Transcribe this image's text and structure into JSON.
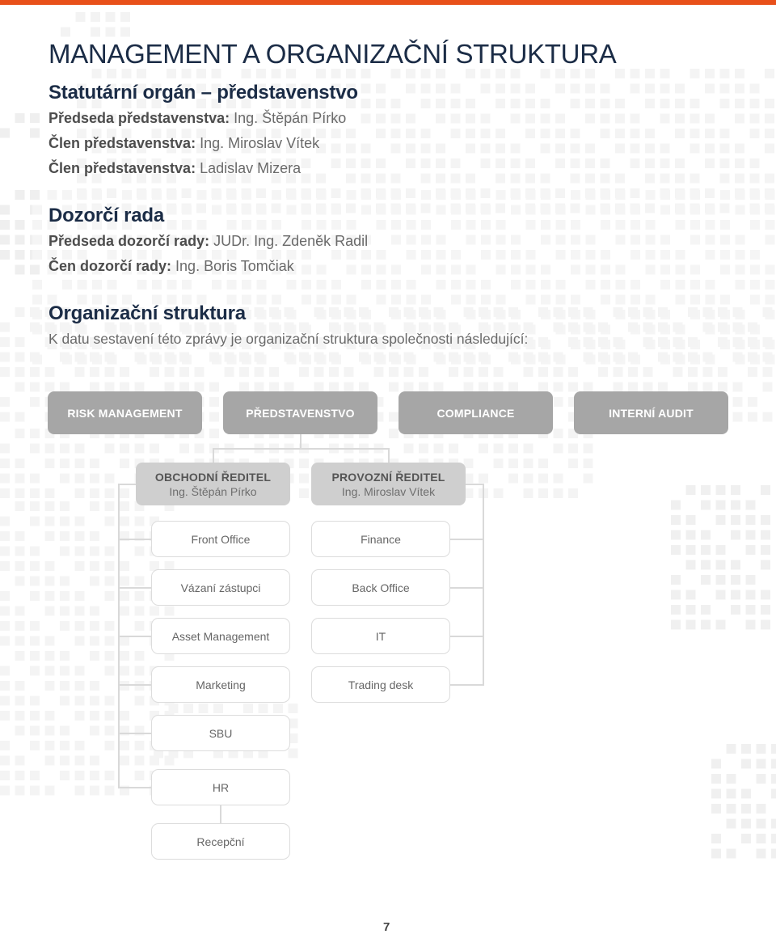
{
  "colors": {
    "accent_bar": "#e8501a",
    "heading": "#1b2c46",
    "top_box": "#a6a6a6",
    "director_box": "#cfcfcf"
  },
  "page": {
    "title": "MANAGEMENT A ORGANIZAČNÍ STRUKTURA",
    "page_number": "7"
  },
  "board": {
    "heading": "Statutární orgán – představenstvo",
    "members": [
      {
        "role": "Předseda představenstva:",
        "name": "Ing. Štěpán Pírko"
      },
      {
        "role": "Člen představenstva:",
        "name": "Ing. Miroslav Vítek"
      },
      {
        "role": "Člen představenstva:",
        "name": "Ladislav Mizera"
      }
    ]
  },
  "supervisory": {
    "heading": "Dozorčí rada",
    "members": [
      {
        "role": "Předseda dozorčí rady:",
        "name": "JUDr. Ing. Zdeněk Radil"
      },
      {
        "role": "Čen dozorčí rady:",
        "name": "Ing. Boris Tomčiak"
      }
    ]
  },
  "org": {
    "heading": "Organizační struktura",
    "intro": "K datu sestavení této zprávy je organizační struktura společnosti následující:",
    "top_units": [
      "RISK MANAGEMENT",
      "PŘEDSTAVENSTVO",
      "COMPLIANCE",
      "INTERNÍ AUDIT"
    ],
    "directors": [
      {
        "title": "OBCHODNÍ ŘEDITEL",
        "name": "Ing. Štěpán Pírko",
        "departments": [
          "Front Office",
          "Vázaní zástupci",
          "Asset Management",
          "Marketing",
          "SBU",
          "HR",
          "Recepční"
        ]
      },
      {
        "title": "PROVOZNÍ ŘEDITEL",
        "name": "Ing. Miroslav Vítek",
        "departments": [
          "Finance",
          "Back Office",
          "IT",
          "Trading desk"
        ]
      }
    ]
  }
}
